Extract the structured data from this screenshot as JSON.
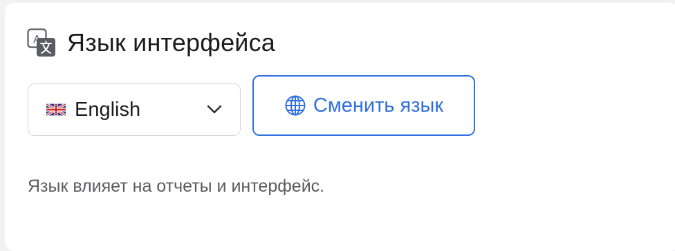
{
  "header": {
    "title": "Язык интерфейса",
    "icon": "language-translate-icon"
  },
  "language_select": {
    "selected_value": "English",
    "flag_icon": "uk-flag-icon",
    "chevron_icon": "chevron-down-icon"
  },
  "change_button": {
    "label": "Сменить язык",
    "icon": "globe-icon",
    "accent_color": "#2f6fde"
  },
  "hint": {
    "text": "Язык влияет на отчеты и интерфейс."
  }
}
